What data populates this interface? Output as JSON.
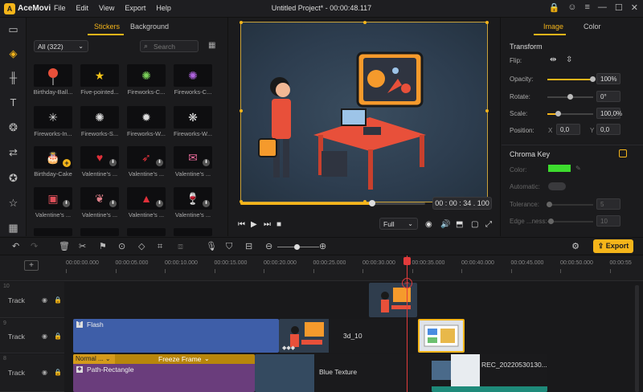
{
  "app": {
    "name": "AceMovi",
    "project_title": "Untitled Project* - 00:00:48.117"
  },
  "menu": [
    "File",
    "Edit",
    "View",
    "Export",
    "Help"
  ],
  "colors": {
    "accent": "#f5b51a",
    "playhead": "#e23b3b",
    "chroma_swatch": "#3ddc2e"
  },
  "rail": [
    "folder-icon",
    "layers-icon",
    "audio-wave-icon",
    "text-icon",
    "filters-icon",
    "transitions-icon",
    "effects-icon",
    "sticker-icon",
    "layout-icon"
  ],
  "stickers": {
    "tabs": [
      "Stickers",
      "Background"
    ],
    "category": "All (322)",
    "search_placeholder": "Search",
    "items": [
      {
        "label": "Birthday-Ball...",
        "icon": "balloon"
      },
      {
        "label": "Five-pointed...",
        "icon": "star"
      },
      {
        "label": "Fireworks-C...",
        "icon": "firework-green"
      },
      {
        "label": "Fireworks-C...",
        "icon": "firework-purple"
      },
      {
        "label": "Fireworks-In...",
        "icon": "firework-white"
      },
      {
        "label": "Fireworks-S...",
        "icon": "firework-ring"
      },
      {
        "label": "Fireworks-W...",
        "icon": "firework-burst"
      },
      {
        "label": "Fireworks-W...",
        "icon": "firework-white2"
      },
      {
        "label": "Birthday-Cake",
        "icon": "cake"
      },
      {
        "label": "Valentine's ...",
        "icon": "heart"
      },
      {
        "label": "Valentine's ...",
        "icon": "heart-arrow"
      },
      {
        "label": "Valentine's ...",
        "icon": "love-letter"
      },
      {
        "label": "Valentine's ...",
        "icon": "card"
      },
      {
        "label": "Valentine's ...",
        "icon": "hands"
      },
      {
        "label": "Valentine's ...",
        "icon": "gift"
      },
      {
        "label": "Valentine's ...",
        "icon": "glasses"
      },
      {
        "label": "",
        "icon": "partial"
      },
      {
        "label": "",
        "icon": "partial"
      },
      {
        "label": "",
        "icon": "partial"
      },
      {
        "label": "",
        "icon": "partial"
      }
    ]
  },
  "preview": {
    "timecode": "00 : 00 : 34 . 100",
    "zoom": "Full",
    "progress": 0.7
  },
  "properties": {
    "tabs": [
      "Image",
      "Color"
    ],
    "transform_title": "Transform",
    "flip_label": "Flip:",
    "opacity_label": "Opacity:",
    "opacity_value": "100%",
    "opacity": 1.0,
    "rotate_label": "Rotate:",
    "rotate_value": "0°",
    "rotate": 0.0,
    "scale_label": "Scale:",
    "scale_value": "100,0%",
    "scale": 0.25,
    "position_label": "Position:",
    "pos_x_label": "X",
    "pos_x": "0,0",
    "pos_y_label": "Y",
    "pos_y": "0,0",
    "chroma_title": "Chroma Key",
    "color_label": "Color:",
    "automatic_label": "Automatic:",
    "tolerance_label": "Tolerance:",
    "tolerance_value": "5",
    "edge_label": "Edge ...ness:",
    "edge_value": "10"
  },
  "toolbar": {
    "export_label": "Export"
  },
  "timeline": {
    "ticks": [
      "00:00:00.000",
      "00:00:05.000",
      "00:00:10.000",
      "00:00:15.000",
      "00:00:20.000",
      "00:00:25.000",
      "00:00:30.000",
      "00:00:35.000",
      "00:00:40.000",
      "00:00:45.000",
      "00:00:50.000",
      "00:00:55"
    ],
    "tracks": [
      {
        "number": "10",
        "name": "Track"
      },
      {
        "number": "9",
        "name": "Track"
      },
      {
        "number": "8",
        "name": "Track"
      }
    ],
    "clips": {
      "flash": "Flash",
      "clip3d": "3d_10",
      "normal": "Normal ...",
      "freeze": "Freeze Frame",
      "path": "Path-Rectangle",
      "blue": "Blue Texture",
      "rec": "REC_20220530130..."
    }
  }
}
